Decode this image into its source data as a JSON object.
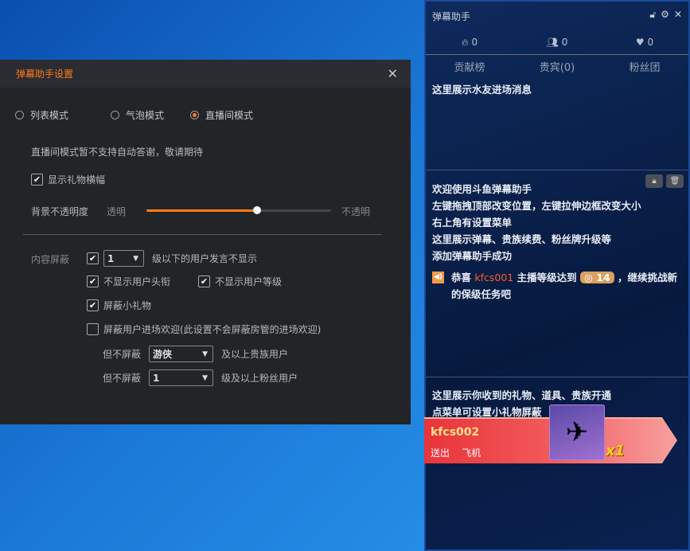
{
  "settings": {
    "title": "弹幕助手设置",
    "modes": [
      "列表模式",
      "气泡模式",
      "直播间模式"
    ],
    "selected_mode": 2,
    "mode_note": "直播间模式暂不支持自动答谢，敬请期待",
    "show_gift_banner": "显示礼物横幅",
    "opacity_label": "背景不透明度",
    "opacity_min": "透明",
    "opacity_max": "不透明",
    "opacity_value": 0.6,
    "block_label": "内容屏蔽",
    "level_value": "1",
    "level_suffix": "级以下的用户发言不显示",
    "hide_title": "不显示用户头衔",
    "hide_level": "不显示用户等级",
    "block_small_gift": "屏蔽小礼物",
    "block_enter": "屏蔽用户进场欢迎(此设置不会屏蔽房管的进场欢迎)",
    "except1_label": "但不屏蔽",
    "noble_value": "游侠",
    "noble_suffix": "及以上贵族用户",
    "except2_label": "但不屏蔽",
    "fan_value": "1",
    "fan_suffix": "级及以上粉丝用户"
  },
  "panel": {
    "title": "弹幕助手",
    "stats": [
      "0",
      "0",
      "0"
    ],
    "tabs": [
      "贡献榜",
      "贵宾(0)",
      "粉丝团"
    ],
    "enter_msg": "这里展示水友进场消息",
    "welcome": [
      "欢迎使用斗鱼弹幕助手",
      "左键拖拽顶部改变位置，左键拉伸边框改变大小",
      "右上角有设置菜单",
      "这里展示弹幕、贵族续费、粉丝牌升级等",
      "添加弹幕助手成功"
    ],
    "congrats": {
      "prefix": "恭喜",
      "user": "kfcs001",
      "mid": "主播等级达到",
      "level": "14",
      "suffix": "，继续挑战新的保级任务吧"
    },
    "gift_msg": [
      "这里展示你收到的礼物、道具、贵族开通",
      "点菜单可设置小礼物屏蔽"
    ],
    "gift_banner": {
      "user": "kfcs002",
      "action": "送出",
      "gift": "飞机",
      "count": "x1"
    }
  },
  "colors": {
    "accent": "#ff7a1a",
    "user": "#ff5a2a"
  }
}
